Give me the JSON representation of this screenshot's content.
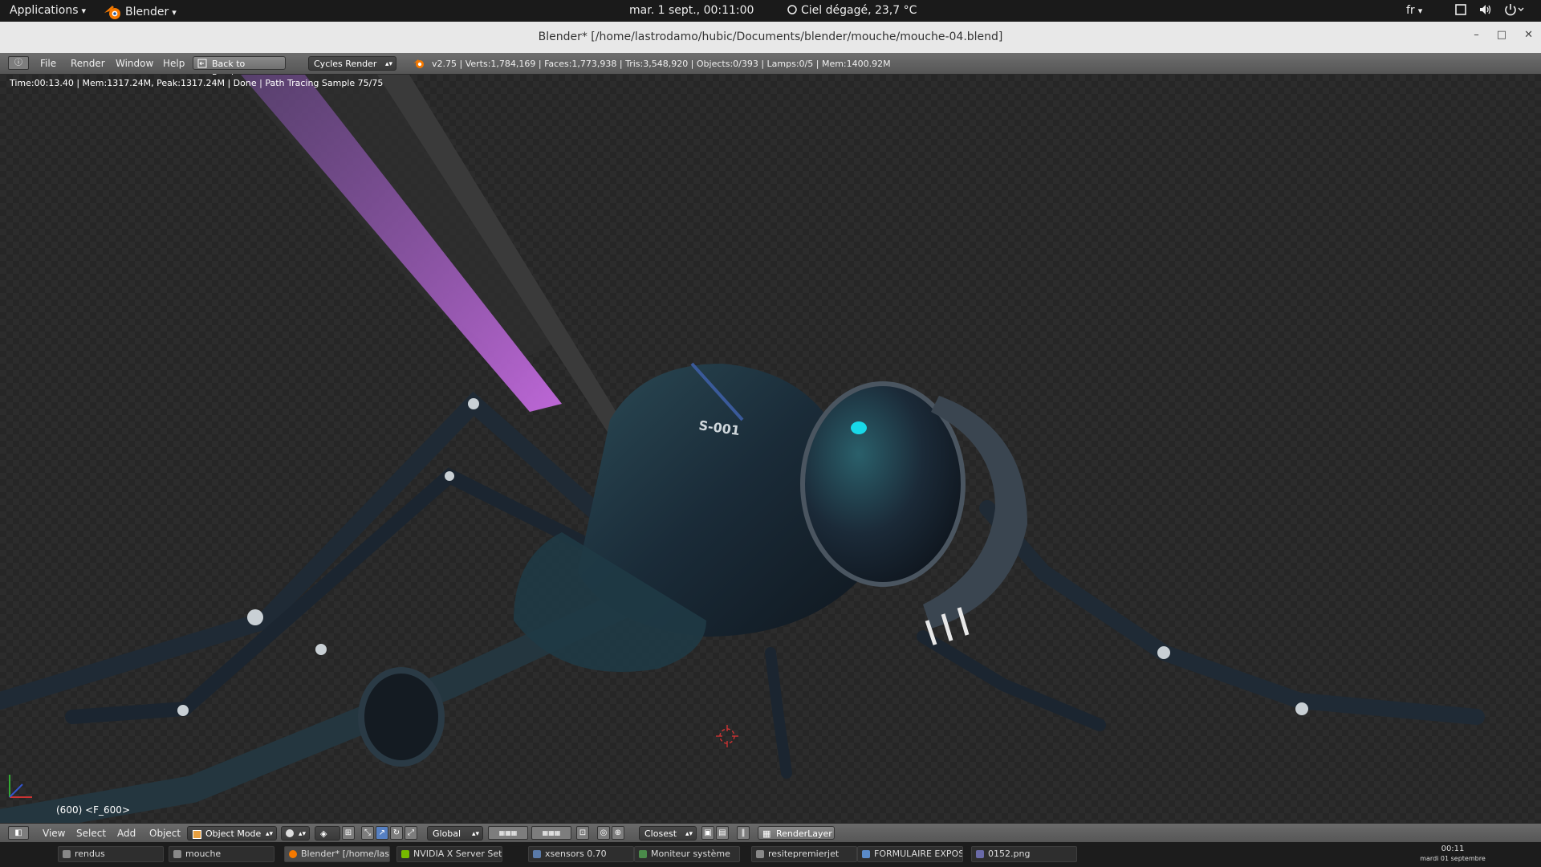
{
  "topbar": {
    "applications": "Applications",
    "app": "Blender",
    "datetime": "mar.  1 sept., 00:11:00",
    "weather": "Ciel dégagé, 23,7 °C",
    "lang": "fr"
  },
  "window": {
    "title": "Blender* [/home/lastrodamo/hubic/Documents/blender/mouche/mouche-04.blend]",
    "minimize": "–",
    "maximize": "□",
    "close": "✕"
  },
  "header": {
    "menus": [
      "File",
      "Render",
      "Window",
      "Help"
    ],
    "back_button": "Back to Previous",
    "render_engine": "Cycles Render",
    "stats": "v2.75 | Verts:1,784,169 | Faces:1,773,938 | Tris:3,548,920 | Objects:0/393 | Lamps:0/5 | Mem:1400.92M"
  },
  "viewport": {
    "render_info": "Time:00:13.40 | Mem:1317.24M, Peak:1317.24M | Done | Path Tracing Sample 75/75",
    "frame_info": "(600) <F_600>"
  },
  "bottombar": {
    "menus": [
      "View",
      "Select",
      "Add",
      "Object"
    ],
    "mode": "Object Mode",
    "orientation": "Global",
    "snap": "Closest",
    "render_layer": "RenderLayer"
  },
  "taskbar": {
    "tasks": [
      "rendus",
      "mouche",
      "Blender* [/home/las...",
      "NVIDIA X Server Sett...",
      "xsensors 0.70",
      "Moniteur système",
      "resitepremierjet",
      "FORMULAIRE EXPOS...",
      "0152.png"
    ],
    "clock_time": "00:11",
    "clock_date": "mardi 01 septembre"
  },
  "colors": {
    "accent_blender": "#f57900",
    "render_body": "#1f3a45",
    "render_cyan": "#18d8e8",
    "render_purple": "#b05ad8"
  }
}
